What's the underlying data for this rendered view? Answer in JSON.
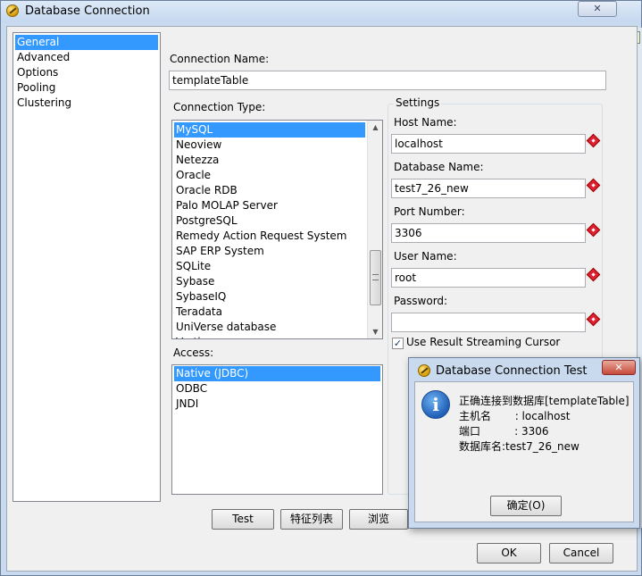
{
  "window": {
    "title": "Database Connection",
    "close_glyph": "✕"
  },
  "background_peek": {
    "label_fragment": "e:"
  },
  "nav": {
    "items": [
      {
        "label": "General",
        "selected": true
      },
      {
        "label": "Advanced",
        "selected": false
      },
      {
        "label": "Options",
        "selected": false
      },
      {
        "label": "Pooling",
        "selected": false
      },
      {
        "label": "Clustering",
        "selected": false
      }
    ]
  },
  "general": {
    "connection_name_label": "Connection Name:",
    "connection_name_value": "templateTable",
    "connection_type_label": "Connection Type:",
    "connection_types": [
      {
        "label": "MySQL",
        "selected": true
      },
      {
        "label": "Neoview",
        "selected": false
      },
      {
        "label": "Netezza",
        "selected": false
      },
      {
        "label": "Oracle",
        "selected": false
      },
      {
        "label": "Oracle RDB",
        "selected": false
      },
      {
        "label": "Palo MOLAP Server",
        "selected": false
      },
      {
        "label": "PostgreSQL",
        "selected": false
      },
      {
        "label": "Remedy Action Request System",
        "selected": false
      },
      {
        "label": "SAP ERP System",
        "selected": false
      },
      {
        "label": "SQLite",
        "selected": false
      },
      {
        "label": "Sybase",
        "selected": false
      },
      {
        "label": "SybaseIQ",
        "selected": false
      },
      {
        "label": "Teradata",
        "selected": false
      },
      {
        "label": "UniVerse database",
        "selected": false
      },
      {
        "label": "Vertica",
        "selected": false
      }
    ],
    "access_label": "Access:",
    "access_options": [
      {
        "label": "Native (JDBC)",
        "selected": true
      },
      {
        "label": "ODBC",
        "selected": false
      },
      {
        "label": "JNDI",
        "selected": false
      }
    ]
  },
  "settings": {
    "group_label": "Settings",
    "host_name_label": "Host Name:",
    "host_name_value": "localhost",
    "database_name_label": "Database Name:",
    "database_name_value": "test7_26_new",
    "port_number_label": "Port Number:",
    "port_number_value": "3306",
    "user_name_label": "User Name:",
    "user_name_value": "root",
    "password_label": "Password:",
    "password_value": "",
    "streaming_cursor_label": "Use Result Streaming Cursor",
    "streaming_cursor_checked": true
  },
  "buttons": {
    "test": "Test",
    "feature_list": "特征列表",
    "browse": "浏览",
    "ok": "OK",
    "cancel": "Cancel"
  },
  "dialog": {
    "title": "Database Connection Test",
    "close_glyph": "✕",
    "lines": [
      "正确连接到数据库[templateTable]",
      "主机名       : localhost",
      "端口          : 3306",
      "数据库名:test7_26_new"
    ],
    "ok_button": "确定(O)"
  },
  "colors": {
    "selection": "#3399ff",
    "window_frame": "#c9daee"
  }
}
